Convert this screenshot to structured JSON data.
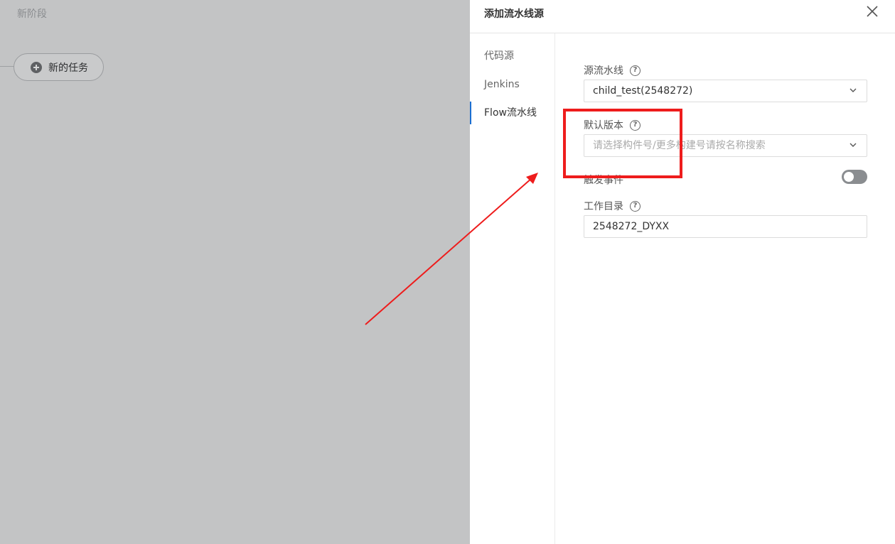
{
  "background": {
    "stage_title": "新阶段",
    "new_task_label": "新的任务"
  },
  "drawer": {
    "title": "添加流水线源",
    "nav": [
      {
        "label": "代码源",
        "active": false
      },
      {
        "label": "Jenkins",
        "active": false
      },
      {
        "label": "Flow流水线",
        "active": true
      }
    ],
    "fields": {
      "source_pipeline": {
        "label": "源流水线",
        "value": "child_test(2548272)"
      },
      "default_version": {
        "label": "默认版本",
        "placeholder": "请选择构件号/更多构建号请按名称搜索"
      },
      "trigger_event": {
        "label": "触发事件",
        "enabled": false
      },
      "work_dir": {
        "label": "工作目录",
        "value": "2548272_DYXX"
      }
    }
  },
  "colors": {
    "accent": "#1b6fd1",
    "annotation": "#ee1c1c",
    "mask": "#c3c4c5"
  }
}
